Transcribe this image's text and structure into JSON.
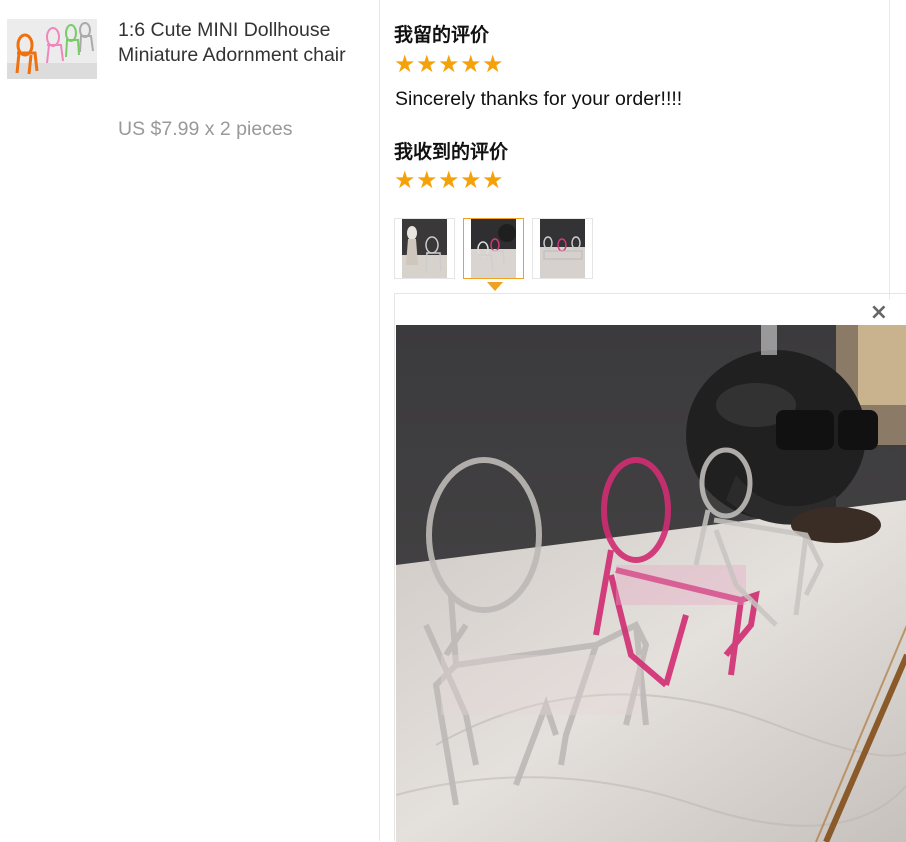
{
  "product": {
    "title": "1:6 Cute MINI Dollhouse Miniature Adornment chair",
    "price": "US $7.99 x 2 pieces"
  },
  "review": {
    "my_review_heading": "我留的评价",
    "my_rating": 5,
    "comment": "Sincerely thanks for your order!!!!",
    "received_review_heading": "我收到的评价",
    "received_rating": 5,
    "star_glyph": "★",
    "star_color": "#f5a20a"
  },
  "gallery": {
    "thumbnails": [
      "photo-1",
      "photo-2",
      "photo-3"
    ],
    "active_index": 1,
    "active_border_color": "#f0a020",
    "close_label": "×"
  }
}
